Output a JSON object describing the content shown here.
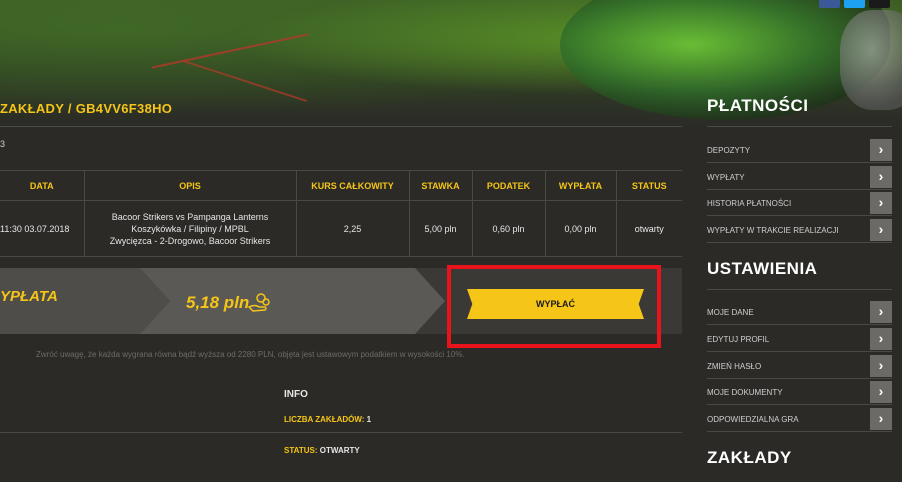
{
  "breadcrumb": "ZAKŁADY / GB4VV6F38HO",
  "bet_id_partial": "3",
  "table": {
    "headers": [
      "DATA",
      "OPIS",
      "KURS CAŁKOWITY",
      "STAWKA",
      "PODATEK",
      "WYPŁATA",
      "STATUS"
    ],
    "row": {
      "date": "11:30 03.07.2018",
      "desc_line1": "Bacoor Strikers vs Pampanga Lanterns",
      "desc_line2": "Koszykówka / Filipiny / MPBL",
      "desc_line3": "Zwycięzca - 2-Drogowo, Bacoor Strikers",
      "odds": "2,25",
      "stake": "5,00 pln",
      "tax": "0,60 pln",
      "payout": "0,00 pln",
      "status": "otwarty"
    }
  },
  "cashout": {
    "label": "YPŁATA",
    "amount": "5,18 pln",
    "button": "WYPŁAĆ"
  },
  "note": "Zwróć uwagę, że każda wygrana równa bądź wyższa od 2280 PLN, objęta jest ustawowym podatkiem w wysokości 10%.",
  "info": {
    "title": "INFO",
    "count_label": "LICZBA ZAKŁADÓW:",
    "count_value": "1",
    "status_label": "STATUS:",
    "status_value": "OTWARTY"
  },
  "sidebar": {
    "payments_title": "PŁATNOŚCI",
    "payments": [
      "DEPOZYTY",
      "WYPŁATY",
      "HISTORIA PŁATNOŚCI",
      "WYPŁATY W TRAKCIE REALIZACJI"
    ],
    "settings_title": "USTAWIENIA",
    "settings": [
      "MOJE DANE",
      "EDYTUJ PROFIL",
      "ZMIEŃ HASŁO",
      "MOJE DOKUMENTY",
      "ODPOWIEDZIALNA GRA"
    ],
    "bets_title": "ZAKŁADY"
  },
  "colors": {
    "accent": "#f5c518",
    "highlight": "#e8131b",
    "background": "#2b2a27"
  }
}
